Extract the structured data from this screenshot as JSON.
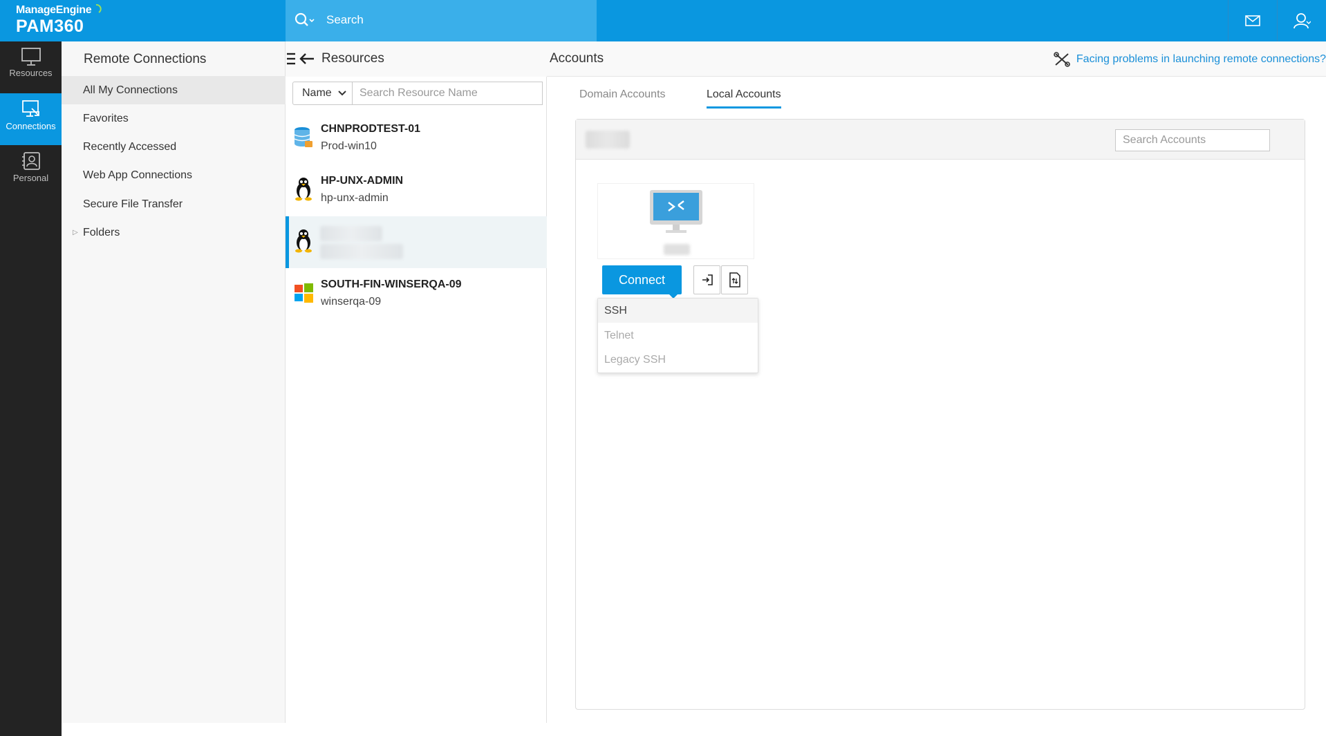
{
  "header": {
    "brand": "ManageEngine",
    "product": "PAM360",
    "search_placeholder": "Search",
    "colors": {
      "primary": "#0a97e0",
      "search_bg": "#3aafea",
      "rail_bg": "#232323"
    },
    "icons": [
      "search-icon",
      "mail-icon",
      "user-icon"
    ]
  },
  "rail": {
    "items": [
      {
        "label": "Resources",
        "icon": "monitor-icon",
        "active": false
      },
      {
        "label": "Connections",
        "icon": "connections-icon",
        "active": true
      },
      {
        "label": "Personal",
        "icon": "personal-icon",
        "active": false
      }
    ]
  },
  "nav": {
    "title": "Remote Connections",
    "items": [
      {
        "label": "All My Connections",
        "active": true
      },
      {
        "label": "Favorites"
      },
      {
        "label": "Recently Accessed"
      },
      {
        "label": "Web App Connections"
      },
      {
        "label": "Secure File Transfer"
      },
      {
        "label": "Folders",
        "expandable": true
      }
    ]
  },
  "resources": {
    "title": "Resources",
    "filter_select": "Name",
    "search_placeholder": "Search Resource Name",
    "items": [
      {
        "name": "CHNPRODTEST-01",
        "sub": "Prod-win10",
        "icon": "database-icon"
      },
      {
        "name": "HP-UNX-ADMIN",
        "sub": "hp-unx-admin",
        "icon": "linux-icon"
      },
      {
        "name": "",
        "sub": "",
        "icon": "linux-icon",
        "selected": true,
        "redacted": true
      },
      {
        "name": "SOUTH-FIN-WINSERQA-09",
        "sub": "winserqa-09",
        "icon": "windows-icon"
      }
    ]
  },
  "accounts": {
    "title": "Accounts",
    "help_link": "Facing problems in launching remote connections?",
    "tabs": [
      {
        "label": "Domain Accounts",
        "active": false
      },
      {
        "label": "Local Accounts",
        "active": true
      }
    ],
    "search_placeholder": "Search Accounts",
    "connect_label": "Connect",
    "protocols": [
      {
        "label": "SSH",
        "highlighted": true
      },
      {
        "label": "Telnet"
      },
      {
        "label": "Legacy SSH"
      }
    ]
  }
}
